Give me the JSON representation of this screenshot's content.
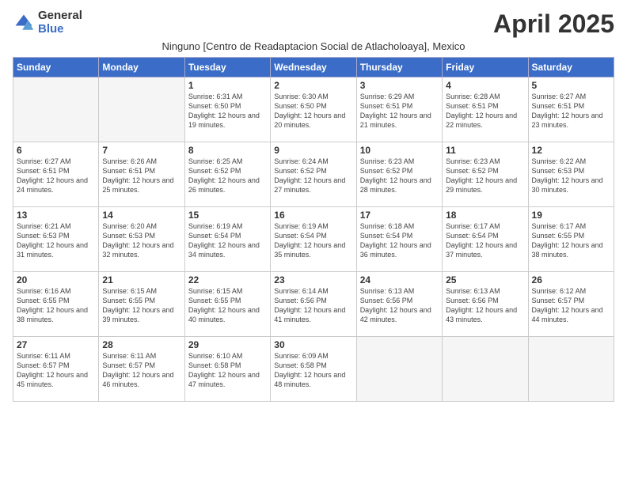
{
  "logo": {
    "general": "General",
    "blue": "Blue"
  },
  "title": "April 2025",
  "subtitle": "Ninguno [Centro de Readaptacion Social de Atlacholoaya], Mexico",
  "days_header": [
    "Sunday",
    "Monday",
    "Tuesday",
    "Wednesday",
    "Thursday",
    "Friday",
    "Saturday"
  ],
  "weeks": [
    [
      {
        "day": "",
        "info": ""
      },
      {
        "day": "",
        "info": ""
      },
      {
        "day": "1",
        "info": "Sunrise: 6:31 AM\nSunset: 6:50 PM\nDaylight: 12 hours and 19 minutes."
      },
      {
        "day": "2",
        "info": "Sunrise: 6:30 AM\nSunset: 6:50 PM\nDaylight: 12 hours and 20 minutes."
      },
      {
        "day": "3",
        "info": "Sunrise: 6:29 AM\nSunset: 6:51 PM\nDaylight: 12 hours and 21 minutes."
      },
      {
        "day": "4",
        "info": "Sunrise: 6:28 AM\nSunset: 6:51 PM\nDaylight: 12 hours and 22 minutes."
      },
      {
        "day": "5",
        "info": "Sunrise: 6:27 AM\nSunset: 6:51 PM\nDaylight: 12 hours and 23 minutes."
      }
    ],
    [
      {
        "day": "6",
        "info": "Sunrise: 6:27 AM\nSunset: 6:51 PM\nDaylight: 12 hours and 24 minutes."
      },
      {
        "day": "7",
        "info": "Sunrise: 6:26 AM\nSunset: 6:51 PM\nDaylight: 12 hours and 25 minutes."
      },
      {
        "day": "8",
        "info": "Sunrise: 6:25 AM\nSunset: 6:52 PM\nDaylight: 12 hours and 26 minutes."
      },
      {
        "day": "9",
        "info": "Sunrise: 6:24 AM\nSunset: 6:52 PM\nDaylight: 12 hours and 27 minutes."
      },
      {
        "day": "10",
        "info": "Sunrise: 6:23 AM\nSunset: 6:52 PM\nDaylight: 12 hours and 28 minutes."
      },
      {
        "day": "11",
        "info": "Sunrise: 6:23 AM\nSunset: 6:52 PM\nDaylight: 12 hours and 29 minutes."
      },
      {
        "day": "12",
        "info": "Sunrise: 6:22 AM\nSunset: 6:53 PM\nDaylight: 12 hours and 30 minutes."
      }
    ],
    [
      {
        "day": "13",
        "info": "Sunrise: 6:21 AM\nSunset: 6:53 PM\nDaylight: 12 hours and 31 minutes."
      },
      {
        "day": "14",
        "info": "Sunrise: 6:20 AM\nSunset: 6:53 PM\nDaylight: 12 hours and 32 minutes."
      },
      {
        "day": "15",
        "info": "Sunrise: 6:19 AM\nSunset: 6:54 PM\nDaylight: 12 hours and 34 minutes."
      },
      {
        "day": "16",
        "info": "Sunrise: 6:19 AM\nSunset: 6:54 PM\nDaylight: 12 hours and 35 minutes."
      },
      {
        "day": "17",
        "info": "Sunrise: 6:18 AM\nSunset: 6:54 PM\nDaylight: 12 hours and 36 minutes."
      },
      {
        "day": "18",
        "info": "Sunrise: 6:17 AM\nSunset: 6:54 PM\nDaylight: 12 hours and 37 minutes."
      },
      {
        "day": "19",
        "info": "Sunrise: 6:17 AM\nSunset: 6:55 PM\nDaylight: 12 hours and 38 minutes."
      }
    ],
    [
      {
        "day": "20",
        "info": "Sunrise: 6:16 AM\nSunset: 6:55 PM\nDaylight: 12 hours and 38 minutes."
      },
      {
        "day": "21",
        "info": "Sunrise: 6:15 AM\nSunset: 6:55 PM\nDaylight: 12 hours and 39 minutes."
      },
      {
        "day": "22",
        "info": "Sunrise: 6:15 AM\nSunset: 6:55 PM\nDaylight: 12 hours and 40 minutes."
      },
      {
        "day": "23",
        "info": "Sunrise: 6:14 AM\nSunset: 6:56 PM\nDaylight: 12 hours and 41 minutes."
      },
      {
        "day": "24",
        "info": "Sunrise: 6:13 AM\nSunset: 6:56 PM\nDaylight: 12 hours and 42 minutes."
      },
      {
        "day": "25",
        "info": "Sunrise: 6:13 AM\nSunset: 6:56 PM\nDaylight: 12 hours and 43 minutes."
      },
      {
        "day": "26",
        "info": "Sunrise: 6:12 AM\nSunset: 6:57 PM\nDaylight: 12 hours and 44 minutes."
      }
    ],
    [
      {
        "day": "27",
        "info": "Sunrise: 6:11 AM\nSunset: 6:57 PM\nDaylight: 12 hours and 45 minutes."
      },
      {
        "day": "28",
        "info": "Sunrise: 6:11 AM\nSunset: 6:57 PM\nDaylight: 12 hours and 46 minutes."
      },
      {
        "day": "29",
        "info": "Sunrise: 6:10 AM\nSunset: 6:58 PM\nDaylight: 12 hours and 47 minutes."
      },
      {
        "day": "30",
        "info": "Sunrise: 6:09 AM\nSunset: 6:58 PM\nDaylight: 12 hours and 48 minutes."
      },
      {
        "day": "",
        "info": ""
      },
      {
        "day": "",
        "info": ""
      },
      {
        "day": "",
        "info": ""
      }
    ]
  ]
}
